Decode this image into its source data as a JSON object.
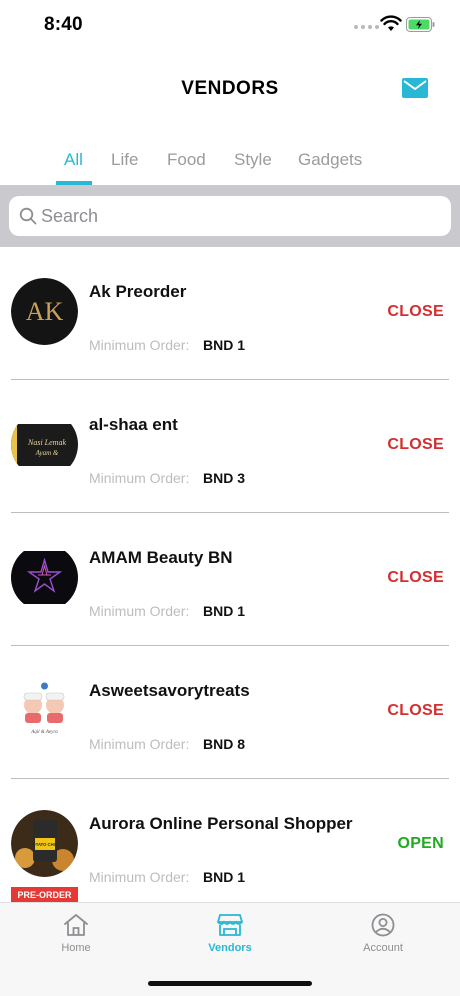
{
  "status_bar": {
    "time": "8:40"
  },
  "header": {
    "title": "VENDORS",
    "mail_icon": "mail-icon"
  },
  "tabs": [
    {
      "label": "All",
      "active": true
    },
    {
      "label": "Life",
      "active": false
    },
    {
      "label": "Food",
      "active": false
    },
    {
      "label": "Style",
      "active": false
    },
    {
      "label": "Gadgets",
      "active": false
    }
  ],
  "search": {
    "placeholder": "Search",
    "value": ""
  },
  "vendors": [
    {
      "name": "Ak Preorder",
      "min_label": "Minimum Order:",
      "min_value": "BND 1",
      "status": "CLOSE",
      "logo_text": "AK"
    },
    {
      "name": "al-shaa ent",
      "min_label": "Minimum Order:",
      "min_value": "BND 3",
      "status": "CLOSE",
      "logo_text": "Nasi Lemak"
    },
    {
      "name": "AMAM Beauty BN",
      "min_label": "Minimum Order:",
      "min_value": "BND 1",
      "status": "CLOSE",
      "logo_text": ""
    },
    {
      "name": "Asweetsavorytreats",
      "min_label": "Minimum Order:",
      "min_value": "BND 8",
      "status": "CLOSE",
      "logo_text": ""
    },
    {
      "name": "Aurora Online Personal Shopper",
      "min_label": "Minimum Order:",
      "min_value": "BND 1",
      "status": "OPEN",
      "badge": "PRE-ORDER",
      "logo_text": "POTATO CHIPS"
    }
  ],
  "colors": {
    "accent": "#29b7d6",
    "close": "#d32f2f",
    "open": "#1faa1f",
    "badge": "#e53935"
  },
  "bottom_nav": [
    {
      "label": "Home",
      "icon": "home-icon",
      "active": false
    },
    {
      "label": "Vendors",
      "icon": "store-icon",
      "active": true
    },
    {
      "label": "Account",
      "icon": "account-icon",
      "active": false
    }
  ]
}
